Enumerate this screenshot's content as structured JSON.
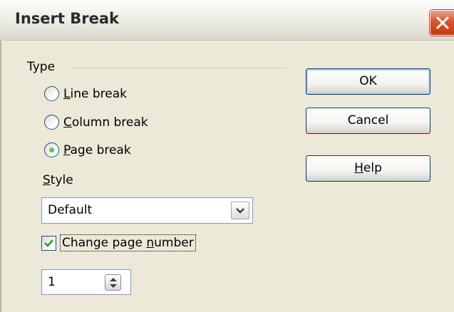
{
  "window": {
    "title": "Insert Break"
  },
  "type_group": {
    "label": "Type",
    "options": [
      {
        "mnemonic": "L",
        "rest": "ine break",
        "selected": false
      },
      {
        "mnemonic": "C",
        "rest": "olumn break",
        "selected": false
      },
      {
        "mnemonic": "P",
        "rest": "age break",
        "selected": true
      }
    ]
  },
  "style": {
    "mnemonic": "S",
    "rest": "tyle",
    "value": "Default"
  },
  "change_page_number": {
    "before": "Change page ",
    "mnemonic": "n",
    "after": "umber",
    "checked": true
  },
  "page_number": {
    "value": "1"
  },
  "buttons": {
    "ok": "OK",
    "cancel": "Cancel",
    "help_mnemonic": "H",
    "help_rest": "elp"
  },
  "colors": {
    "title_close": "#c23b14",
    "radio_dot": "#21a121",
    "check": "#21a121"
  },
  "icons": {
    "close": "close-icon",
    "dropdown": "chevron-down-icon",
    "spin": "spin-updown-icon",
    "check": "checkmark-icon"
  }
}
